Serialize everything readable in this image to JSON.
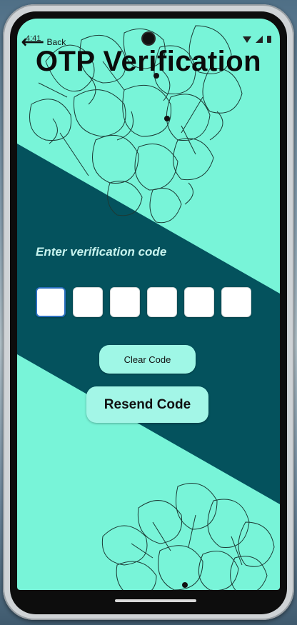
{
  "status_bar": {
    "time": "4:41"
  },
  "header": {
    "back_label": "Back",
    "title": "OTP Verification"
  },
  "verification": {
    "prompt": "Enter verification code",
    "code_length": 6,
    "clear_label": "Clear Code",
    "resend_label": "Resend Code"
  },
  "colors": {
    "background": "#78f4d8",
    "band": "#04525d",
    "button": "#9ff7e6",
    "focus_border": "#2a6fbf"
  },
  "icons": [
    "back-arrow-icon",
    "wifi-icon",
    "signal-icon",
    "battery-icon",
    "flower-illustration"
  ]
}
